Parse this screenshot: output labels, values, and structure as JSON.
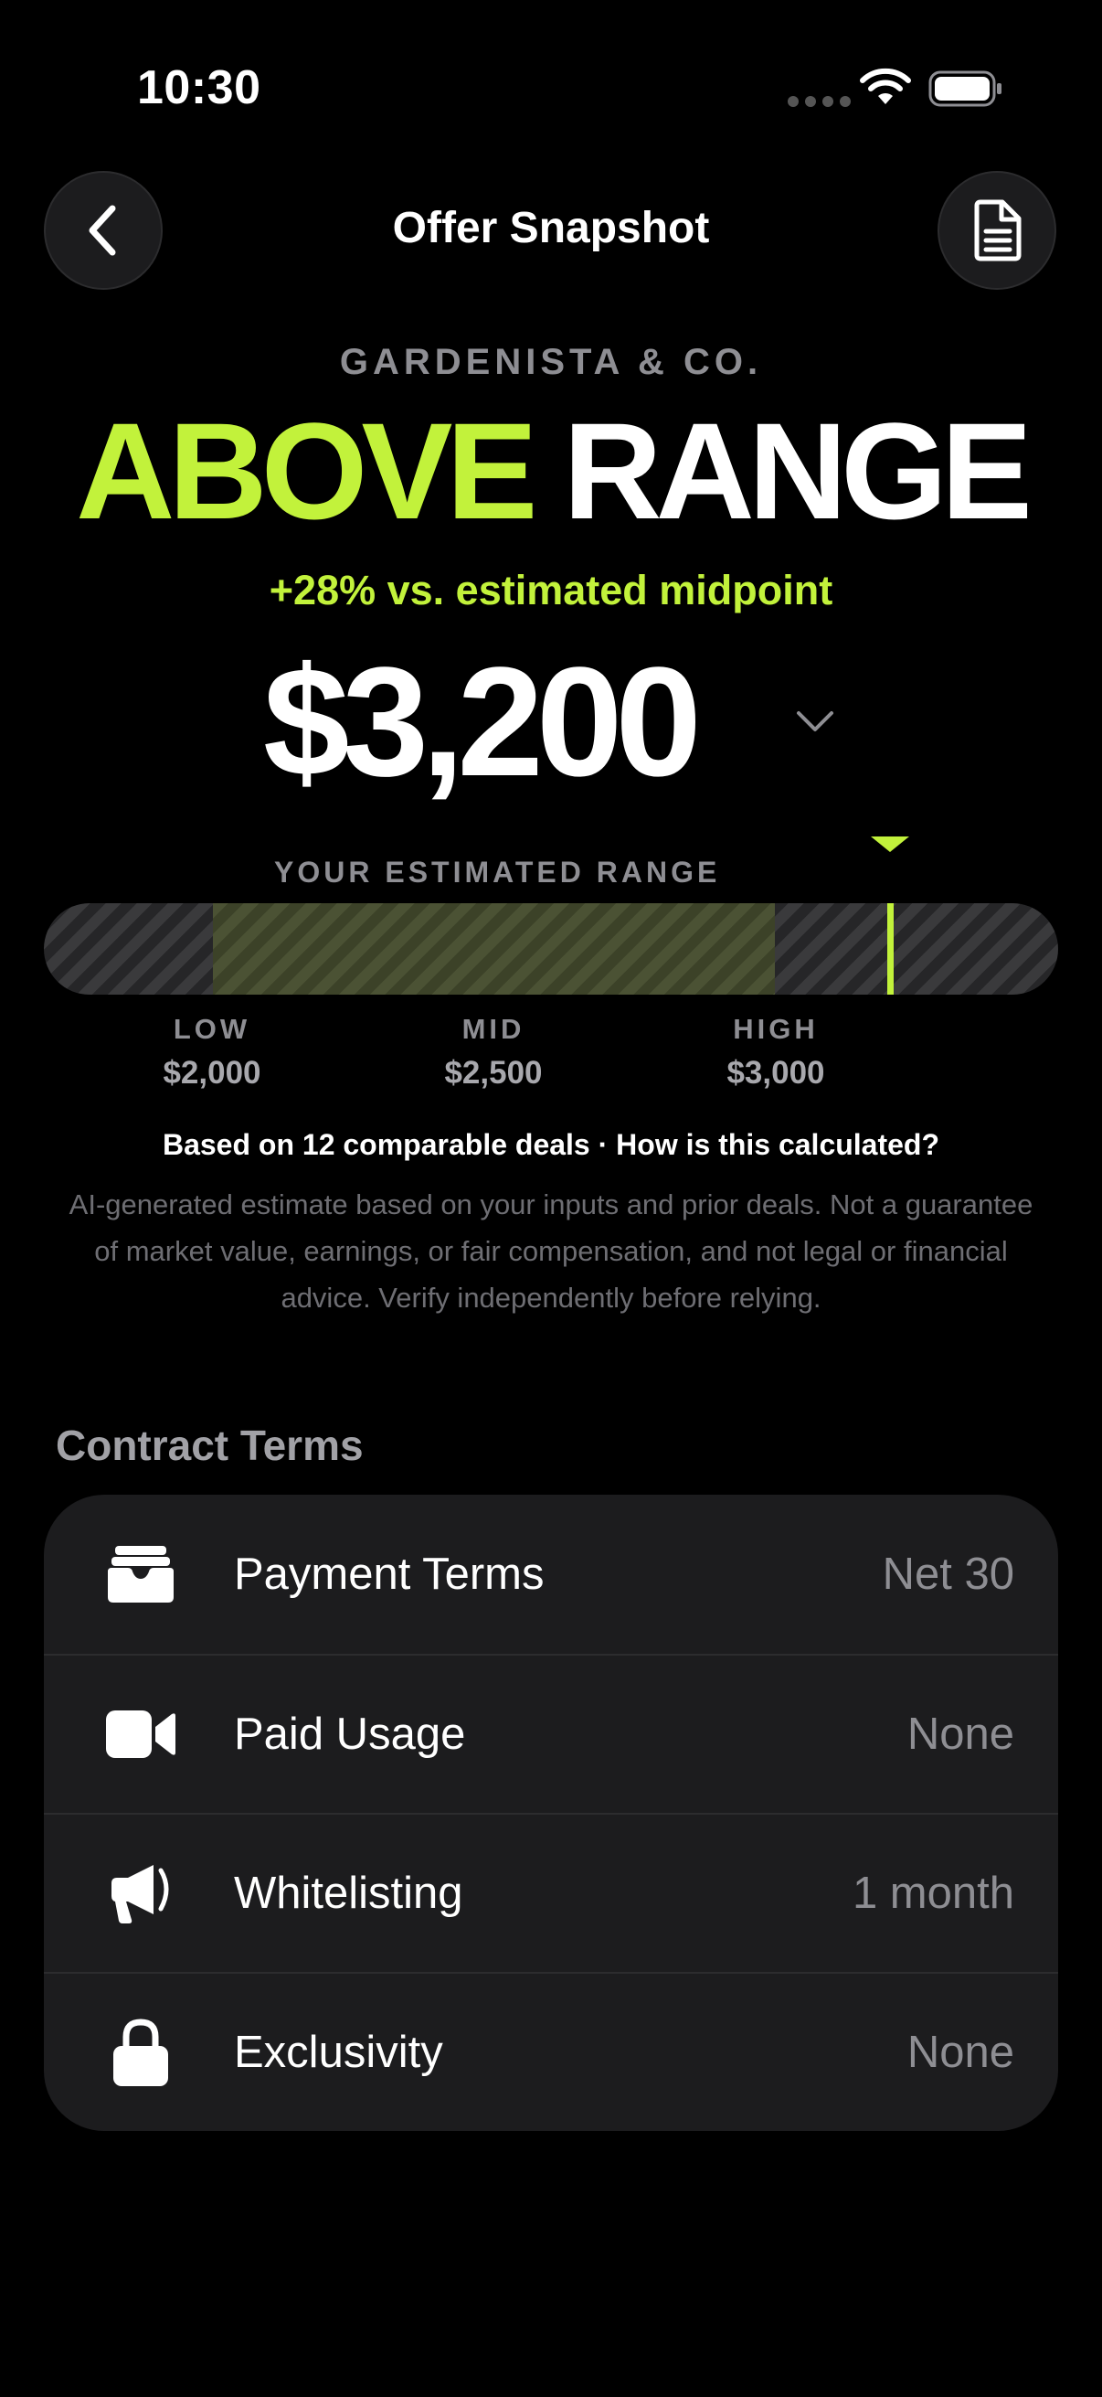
{
  "status_bar": {
    "time": "10:30"
  },
  "nav": {
    "title": "Offer Snapshot"
  },
  "offer": {
    "brand": "GARDENISTA & CO.",
    "status_accent": "ABOVE",
    "status_rest": "RANGE",
    "delta": "+28% vs. estimated midpoint",
    "amount": "$3,200"
  },
  "range": {
    "label": "YOUR ESTIMATED RANGE",
    "low_label": "LOW",
    "low_value": "$2,000",
    "mid_label": "MID",
    "mid_value": "$2,500",
    "high_label": "HIGH",
    "high_value": "$3,000",
    "offer_value": 3200,
    "low": 2000,
    "high": 3000
  },
  "basis": "Based on 12 comparable deals · How is this calculated?",
  "disclaimer": "AI-generated estimate based on your inputs and prior deals. Not a guarantee of market value, earnings, or fair compensation, and not legal or financial advice. Verify independently before relying.",
  "contract_terms": {
    "title": "Contract Terms",
    "rows": [
      {
        "icon": "wallet-icon",
        "label": "Payment Terms",
        "value": "Net 30"
      },
      {
        "icon": "video-camera-icon",
        "label": "Paid Usage",
        "value": "None"
      },
      {
        "icon": "megaphone-icon",
        "label": "Whitelisting",
        "value": "1 month"
      },
      {
        "icon": "lock-icon",
        "label": "Exclusivity",
        "value": "None"
      }
    ]
  },
  "colors": {
    "accent": "#c2f23b",
    "background": "#000000",
    "card": "#1c1c1e"
  }
}
